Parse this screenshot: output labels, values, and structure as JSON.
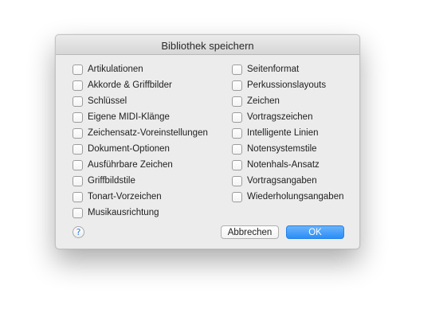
{
  "dialog": {
    "title": "Bibliothek speichern",
    "left_options": [
      {
        "label": "Artikulationen",
        "checked": false
      },
      {
        "label": "Akkorde & Griffbilder",
        "checked": false
      },
      {
        "label": "Schlüssel",
        "checked": false
      },
      {
        "label": "Eigene MIDI-Klänge",
        "checked": false
      },
      {
        "label": "Zeichensatz-Voreinstellungen",
        "checked": false
      },
      {
        "label": "Dokument-Optionen",
        "checked": false
      },
      {
        "label": "Ausführbare Zeichen",
        "checked": false
      },
      {
        "label": "Griffbildstile",
        "checked": false
      },
      {
        "label": "Tonart-Vorzeichen",
        "checked": false
      },
      {
        "label": "Musikausrichtung",
        "checked": false
      }
    ],
    "right_options": [
      {
        "label": "Seitenformat",
        "checked": false
      },
      {
        "label": "Perkussionslayouts",
        "checked": false
      },
      {
        "label": "Zeichen",
        "checked": false
      },
      {
        "label": "Vortragszeichen",
        "checked": false
      },
      {
        "label": "Intelligente Linien",
        "checked": false
      },
      {
        "label": "Notensystemstile",
        "checked": false
      },
      {
        "label": "Notenhals-Ansatz",
        "checked": false
      },
      {
        "label": "Vortragsangaben",
        "checked": false
      },
      {
        "label": "Wiederholungsangaben",
        "checked": false
      }
    ],
    "help_label": "?",
    "cancel_label": "Abbrechen",
    "ok_label": "OK",
    "accent_color": "#2a8ef7"
  }
}
